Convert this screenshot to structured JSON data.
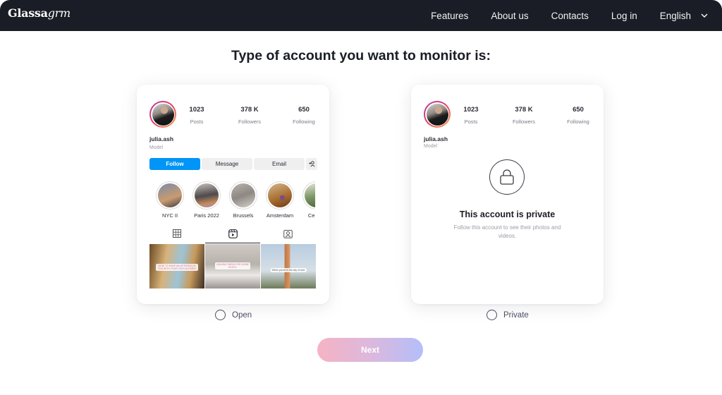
{
  "nav": {
    "logo_bold": "Glassa",
    "logo_italic": "grm",
    "links": [
      "Features",
      "About us",
      "Contacts",
      "Log in"
    ],
    "language": "English"
  },
  "title": "Type of account you want to monitor is:",
  "profile": {
    "username": "julia.ash",
    "role": "Model",
    "stats": [
      {
        "value": "1023",
        "label": "Posts"
      },
      {
        "value": "378 K",
        "label": "Followers"
      },
      {
        "value": "650",
        "label": "Following"
      }
    ],
    "buttons": {
      "follow": "Follow",
      "message": "Message",
      "email": "Email"
    },
    "stories": [
      "NYC II",
      "Paris 2022",
      "Brussels",
      "Amsterdam",
      "Central"
    ],
    "posts": [
      "HOW TO HAVE AN AFTERNOON TEA WITH YOUR CATS IN PARIS",
      "LEAVING PARIS FOR HOME IN NYC",
      "When you're in the city of love"
    ]
  },
  "private_card": {
    "title": "This account is private",
    "subtitle": "Follow this account to see their photos and videos."
  },
  "options": {
    "open": "Open",
    "private": "Private"
  },
  "next_label": "Next"
}
